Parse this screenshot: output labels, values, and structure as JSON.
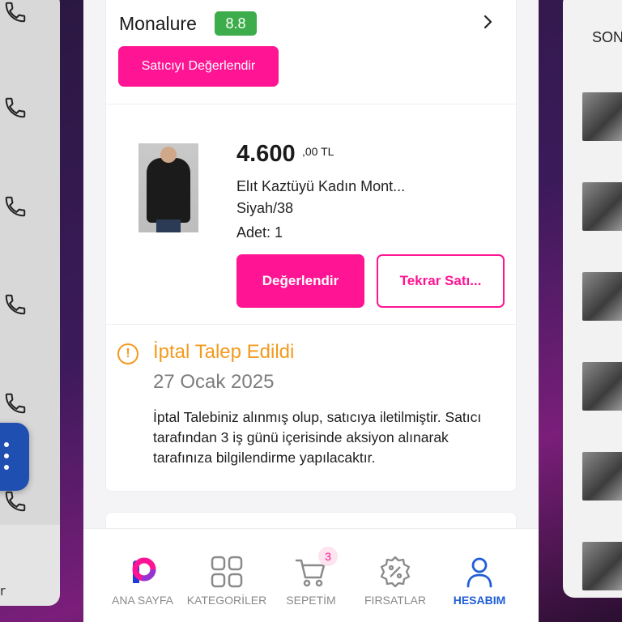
{
  "seller": {
    "name": "Monalure",
    "rating": "8.8",
    "rate_seller_label": "Satıcıyı Değerlendir"
  },
  "product": {
    "price_main": "4.600",
    "price_fraction": ",00 TL",
    "name": "Elıt Kaztüyü Kadın Mont...",
    "variant": "Siyah/38",
    "quantity": "Adet: 1",
    "rate_label": "Değerlendir",
    "rebuy_label": "Tekrar Satı..."
  },
  "status": {
    "title": "İptal Talep Edildi",
    "date": "27 Ocak 2025",
    "description": "İptal Talebiniz alınmış olup, satıcıya iletilmiştir. Satıcı tarafından 3 iş günü içerisinde aksiyon alınarak tarafınıza bilgilendirme yapılacaktır.",
    "icon": "warning-circle-icon",
    "color": "#f39a1e"
  },
  "nav": {
    "items": [
      {
        "label": "ANA SAYFA",
        "icon": "home-logo-icon"
      },
      {
        "label": "KATEGORİLER",
        "icon": "grid-icon"
      },
      {
        "label": "SEPETİM",
        "icon": "cart-icon"
      },
      {
        "label": "FIRSATLAR",
        "icon": "discount-badge-icon"
      },
      {
        "label": "HESABIM",
        "icon": "user-icon"
      }
    ],
    "cart_count": "3",
    "active": "HESABIM"
  },
  "background": {
    "right_title": "SON",
    "left_bottom_text": "r"
  },
  "colors": {
    "brand": "#ff1493",
    "rating_green": "#3cad4a",
    "active_blue": "#1f5ed6"
  }
}
